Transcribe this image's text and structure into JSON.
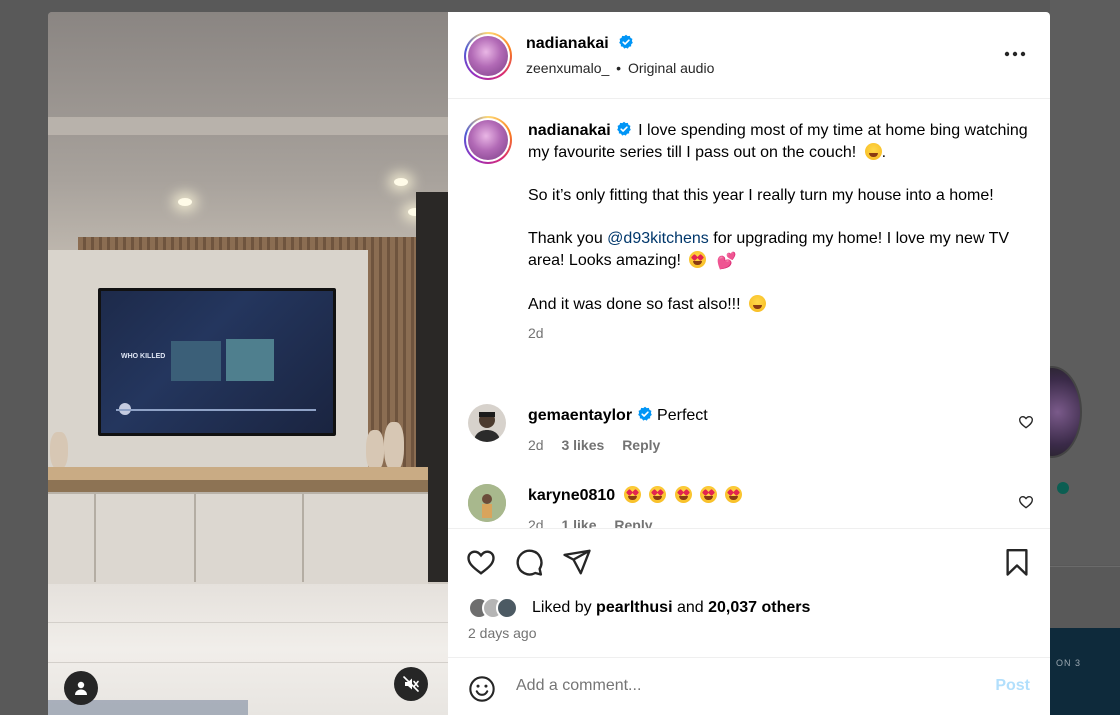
{
  "post": {
    "author": "nadianakai",
    "audio_user": "zeenxumalo_",
    "audio_separator": "•",
    "audio_label": "Original audio",
    "caption": [
      "I love spending most of my time at home bing watching my favourite series till I pass out on the couch!",
      "So it’s only fitting that this year I really turn my house into a home!",
      "Thank you",
      "@d93kitchens",
      "for upgrading my home! I love my new TV area! Looks amazing!",
      "And it was done so fast also!!!"
    ],
    "caption_time": "2d"
  },
  "media": {
    "tv_text": "WHO KILLED"
  },
  "comments": [
    {
      "user": "gemaentaylor",
      "verified": true,
      "text": "Perfect",
      "time": "2d",
      "likes": "3 likes",
      "reply": "Reply"
    },
    {
      "user": "karyne0810",
      "verified": false,
      "text": "",
      "time": "2d",
      "likes": "1 like",
      "reply": "Reply"
    }
  ],
  "likes": {
    "prefix": "Liked by",
    "user": "pearlthusi",
    "and": "and",
    "others": "20,037 others"
  },
  "date": "2 days ago",
  "composer": {
    "placeholder": "Add a comment...",
    "post_label": "Post"
  },
  "backdrop": {
    "tile_text": "ON 3"
  },
  "colors": {
    "verified": "#0095f6",
    "mention": "#00376b",
    "post_disabled": "#b2dffc",
    "meta": "#737373"
  },
  "icons": [
    "verified-icon",
    "more-icon",
    "heart-icon",
    "comment-icon",
    "share-icon",
    "bookmark-icon",
    "smile-icon",
    "user-icon",
    "mute-icon"
  ]
}
